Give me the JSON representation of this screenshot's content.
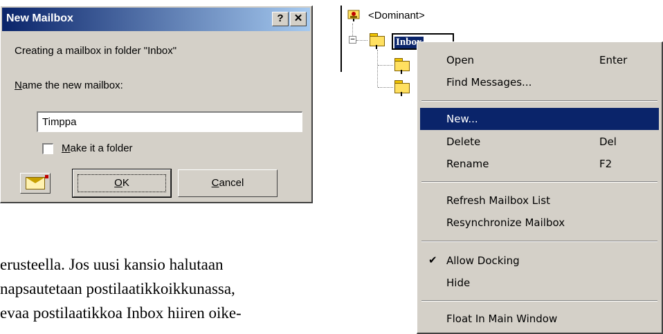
{
  "dialog": {
    "title": "New Mailbox",
    "help_btn": "?",
    "close_btn": "✕",
    "info_text": "Creating a mailbox in folder \"Inbox\"",
    "name_label_accel": "N",
    "name_label_rest": "ame the new mailbox:",
    "name_value": "Timppa",
    "folder_checkbox_accel": "M",
    "folder_checkbox_rest": "ake it a folder",
    "folder_checked": false,
    "ok_accel": "O",
    "ok_rest": "K",
    "cancel_accel": "C",
    "cancel_rest": "ancel"
  },
  "paragraph": {
    "line1": "erusteella. Jos uusi kansio halutaan",
    "line2": "napsautetaan postilaatikkoikkunassa,",
    "line3": "evaa postilaatikkoa Inbox hiiren oike-"
  },
  "tree": {
    "root_label": "<Dominant>",
    "expander": "−",
    "inbox_label": "Inbox"
  },
  "context_menu": {
    "items": [
      {
        "label": "Open",
        "shortcut": "Enter"
      },
      {
        "label": "Find Messages...",
        "shortcut": ""
      },
      {
        "label": "New...",
        "shortcut": "",
        "selected": true
      },
      {
        "label": "Delete",
        "shortcut": "Del"
      },
      {
        "label": "Rename",
        "shortcut": "F2"
      },
      {
        "label": "Refresh Mailbox List",
        "shortcut": ""
      },
      {
        "label": "Resynchronize Mailbox",
        "shortcut": ""
      },
      {
        "label": "Allow Docking",
        "shortcut": "",
        "checked": true
      },
      {
        "label": "Hide",
        "shortcut": ""
      },
      {
        "label": "Float In Main Window",
        "shortcut": ""
      }
    ],
    "check_glyph": "✔"
  }
}
